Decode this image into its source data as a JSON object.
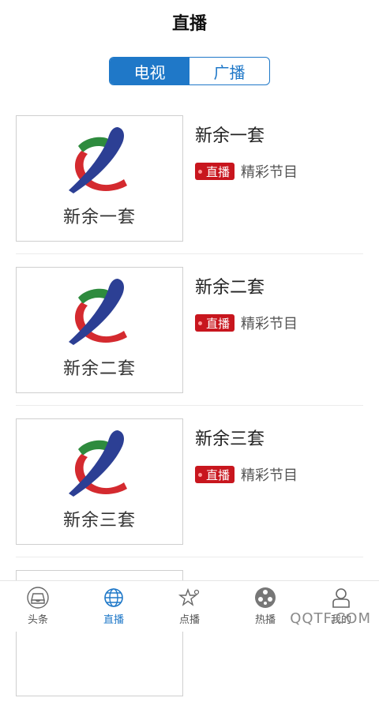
{
  "header": {
    "title": "直播"
  },
  "segmented": {
    "tv_label": "电视",
    "radio_label": "广播",
    "selected": "电视"
  },
  "channels": [
    {
      "logo_caption": "新余一套",
      "name": "新余一套",
      "badge": "直播",
      "program": "精彩节目"
    },
    {
      "logo_caption": "新余二套",
      "name": "新余二套",
      "badge": "直播",
      "program": "精彩节目"
    },
    {
      "logo_caption": "新余三套",
      "name": "新余三套",
      "badge": "直播",
      "program": "精彩节目"
    }
  ],
  "tabbar": {
    "items": [
      {
        "label": "头条",
        "icon": "inbox-icon"
      },
      {
        "label": "直播",
        "icon": "globe-icon"
      },
      {
        "label": "点播",
        "icon": "star-icon"
      },
      {
        "label": "热播",
        "icon": "film-reel-icon"
      },
      {
        "label": "我的",
        "icon": "user-icon"
      }
    ],
    "active": "直播"
  },
  "watermark": "QQTF.COM",
  "colors": {
    "accent": "#1f78c8",
    "live_badge": "#c8161e"
  }
}
